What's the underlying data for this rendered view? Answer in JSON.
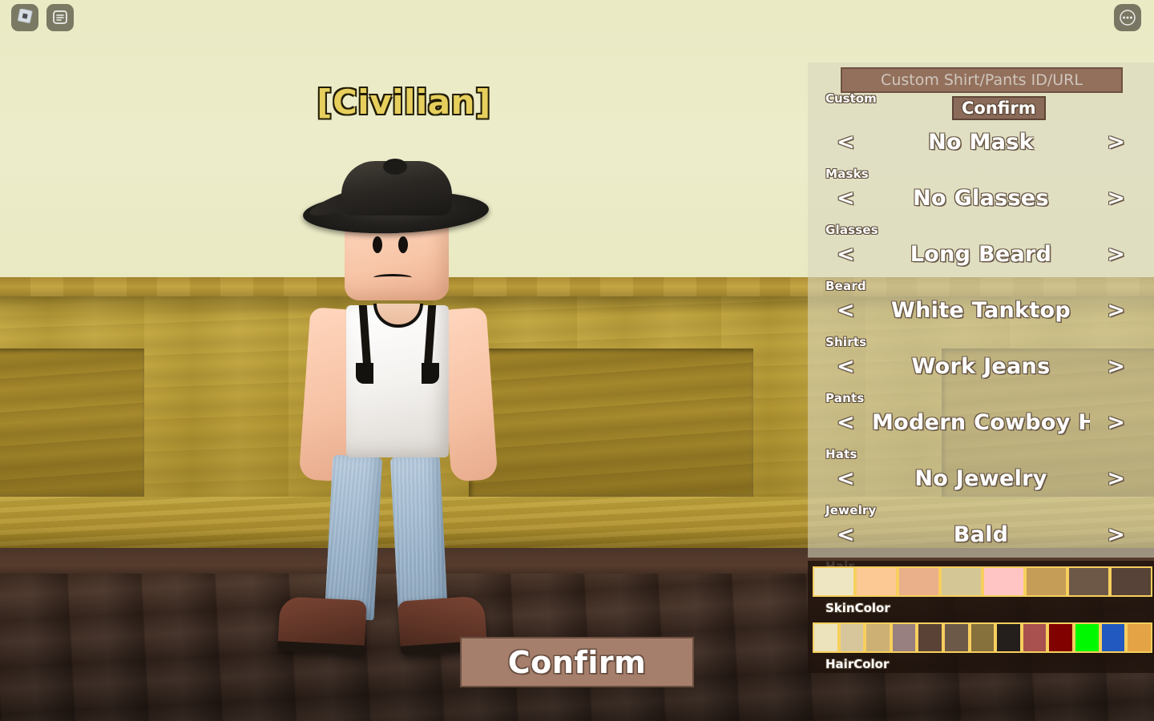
{
  "topbar": {
    "roblox_icon": "roblox-logo-icon",
    "chat_icon": "chat-list-icon",
    "menu_icon": "more-options-icon"
  },
  "character": {
    "title": "[Civilian]"
  },
  "confirm_button": {
    "label": "Confirm"
  },
  "panel": {
    "custom": {
      "category": "Custom",
      "textbox_placeholder": "Custom Shirt/Pants ID/URL",
      "textbox_value": "",
      "confirm_label": "Confirm"
    },
    "arrows": {
      "left": "<",
      "right": ">"
    },
    "slots": [
      {
        "category": "Masks",
        "value": "No Mask"
      },
      {
        "category": "Glasses",
        "value": "No Glasses"
      },
      {
        "category": "Beard",
        "value": "Long Beard"
      },
      {
        "category": "Shirts",
        "value": "White Tanktop"
      },
      {
        "category": "Pants",
        "value": "Work Jeans"
      },
      {
        "category": "Hats",
        "value": "Modern Cowboy Hat"
      },
      {
        "category": "Jewelry",
        "value": "No Jewelry"
      },
      {
        "category": "Hair",
        "value": "Bald"
      }
    ]
  },
  "skin_color": {
    "label": "SkinColor",
    "swatches": [
      "#eee6c3",
      "#fcc894",
      "#eab089",
      "#d4c795",
      "#ffc4c4",
      "#c59d56",
      "#6d5848",
      "#574337"
    ]
  },
  "hair_color": {
    "label": "HairColor",
    "swatches": [
      "#ece2bb",
      "#d7c69c",
      "#cdb074",
      "#97807f",
      "#5a4336",
      "#6d5948",
      "#86703c",
      "#241f1c",
      "#a9514f",
      "#810000",
      "#00f900",
      "#2159c0",
      "#e4a345"
    ]
  },
  "accent_colors": {
    "title_gold": "#e6cf5c",
    "swatch_border": "#f7cf5e",
    "button_brown": "#a57f6b"
  }
}
